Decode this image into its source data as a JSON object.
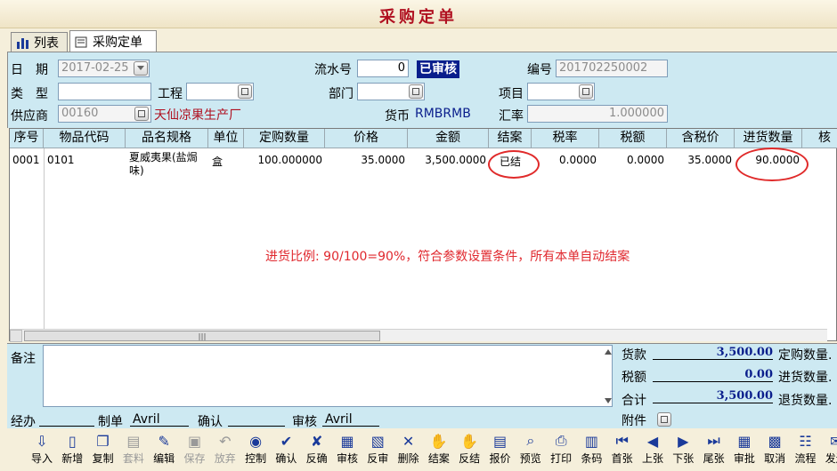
{
  "window": {
    "title": "采购定单"
  },
  "tabs": [
    {
      "label": "列表"
    },
    {
      "label": "采购定单"
    }
  ],
  "form": {
    "date_label": "日　期",
    "date_value": "2017-02-25",
    "serial_label": "流水号",
    "serial_value": "0",
    "status_badge": "已审核",
    "number_label": "编号",
    "number_value": "201702250002",
    "type_label": "类　型",
    "type_value": "",
    "project_label": "工程",
    "project_value": "",
    "dept_label": "部门",
    "dept_value": "",
    "item_label": "项目",
    "item_value": "",
    "supplier_label": "供应商",
    "supplier_code": "00160",
    "supplier_name": "天仙凉果生产厂",
    "currency_label": "货币",
    "currency_value": "RMBRMB",
    "rate_label": "汇率",
    "rate_value": "1.000000"
  },
  "grid": {
    "headers": [
      "序号",
      "物品代码",
      "品名规格",
      "单位",
      "定购数量",
      "价格",
      "金额",
      "结案",
      "税率",
      "税额",
      "含税价",
      "进货数量",
      "核"
    ],
    "rows": [
      {
        "seq": "0001",
        "code": "0101",
        "name_line1": "夏威夷果(盐焗",
        "name_line2": "味)",
        "unit": "盒",
        "qty": "100.000000",
        "price": "35.0000",
        "amount": "3,500.0000",
        "closed": "已结",
        "tax_rate": "0.0000",
        "tax": "0.0000",
        "price_tax": "35.0000",
        "received": "90.0000"
      }
    ],
    "annotation": "进货比例: 90/100=90%，符合参数设置条件，所有本单自动结案"
  },
  "bottom": {
    "memo_label": "备注",
    "goods_label": "货款",
    "goods_value": "3,500.00",
    "tax_label": "税额",
    "tax_value": "0.00",
    "total_label": "合计",
    "total_value": "3,500.00",
    "attach_label": "附件",
    "order_qty_label": "定购数量.",
    "recv_qty_label": "进货数量.",
    "return_qty_label": "退货数量.",
    "handler_label": "经办",
    "handler_value": "",
    "maker_label": "制单",
    "maker_value": "Avril",
    "confirm_label": "确认",
    "confirm_value": "",
    "audit_label": "审核",
    "audit_value": "Avril"
  },
  "toolbar": [
    {
      "label": "导入",
      "icon": "import-icon"
    },
    {
      "label": "新增",
      "icon": "new-icon"
    },
    {
      "label": "复制",
      "icon": "copy-icon"
    },
    {
      "label": "套料",
      "icon": "material-icon"
    },
    {
      "label": "编辑",
      "icon": "edit-icon"
    },
    {
      "label": "保存",
      "icon": "save-icon"
    },
    {
      "label": "放弃",
      "icon": "undo-icon"
    },
    {
      "label": "控制",
      "icon": "control-icon"
    },
    {
      "label": "确认",
      "icon": "confirm-icon"
    },
    {
      "label": "反确",
      "icon": "unconfirm-icon"
    },
    {
      "label": "审核",
      "icon": "audit-icon"
    },
    {
      "label": "反审",
      "icon": "unaudit-icon"
    },
    {
      "label": "删除",
      "icon": "delete-icon"
    },
    {
      "label": "结案",
      "icon": "close-case-icon"
    },
    {
      "label": "反结",
      "icon": "reopen-icon"
    },
    {
      "label": "报价",
      "icon": "quote-icon"
    },
    {
      "label": "预览",
      "icon": "preview-icon"
    },
    {
      "label": "打印",
      "icon": "print-icon"
    },
    {
      "label": "条码",
      "icon": "barcode-icon"
    },
    {
      "label": "首张",
      "icon": "first-icon"
    },
    {
      "label": "上张",
      "icon": "prev-icon"
    },
    {
      "label": "下张",
      "icon": "next-icon"
    },
    {
      "label": "尾张",
      "icon": "last-icon"
    },
    {
      "label": "审批",
      "icon": "approve-icon"
    },
    {
      "label": "取消",
      "icon": "cancel-icon"
    },
    {
      "label": "流程",
      "icon": "flow-icon"
    },
    {
      "label": "发送",
      "icon": "send-icon"
    }
  ],
  "colors": {
    "title": "#b01020",
    "panel": "#cde9f2",
    "badge_bg": "#0a1e8c",
    "annotation": "#e0282e",
    "totals": "#0a1e8c"
  }
}
